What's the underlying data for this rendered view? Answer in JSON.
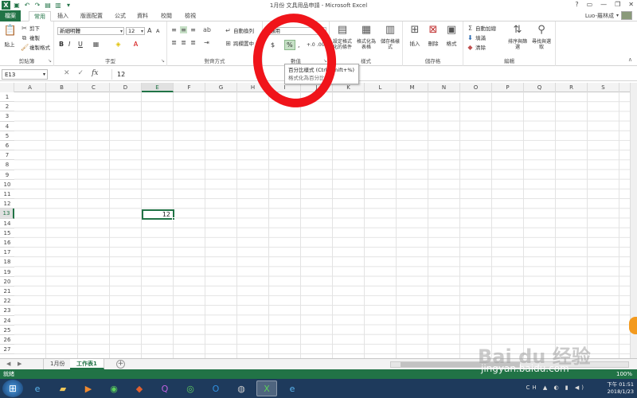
{
  "window": {
    "title": "1月份 文具用品申請 - Microsoft Excel",
    "controls": [
      "?",
      "▭",
      "—",
      "❐",
      "✕"
    ]
  },
  "tabs": [
    "檔案",
    "常用",
    "插入",
    "版面配置",
    "公式",
    "資料",
    "校閱",
    "檢視"
  ],
  "active_tab": "常用",
  "user": {
    "name": "Luo-羅林成"
  },
  "ribbon": {
    "clipboard": {
      "label": "剪貼簿",
      "paste": "貼上",
      "cut": "剪下",
      "copy": "複製",
      "format_painter": "複製格式"
    },
    "font": {
      "label": "字型",
      "font_name": "新細明體",
      "font_size": "12",
      "bold": "B",
      "italic": "I",
      "underline": "U",
      "grow": "A",
      "shrink": "A"
    },
    "alignment": {
      "label": "對齊方式",
      "wrap_text": "自動換列",
      "merge_center": "跨欄置中"
    },
    "number": {
      "label": "數值",
      "format": "通用",
      "currency": "$",
      "percent": "%",
      "comma": ",",
      "increase_decimal": "+.0",
      "decrease_decimal": ".00"
    },
    "styles": {
      "label": "樣式",
      "conditional": "設定格式化的條件",
      "format_table": "格式化為表格",
      "cell_styles": "儲存格樣式"
    },
    "cells": {
      "label": "儲存格",
      "insert": "插入",
      "delete": "刪除",
      "format": "格式"
    },
    "editing": {
      "label": "編輯",
      "autosum": "自動加總",
      "fill": "填滿",
      "clear": "清除",
      "sort_filter": "排序與篩選",
      "find_select": "尋找與選取"
    }
  },
  "tooltip": {
    "line1": "百分比樣式 (Ctrl+Shift+%)",
    "line2": "格式化為百分比。"
  },
  "formula_bar": {
    "name_box": "E13",
    "cancel": "✕",
    "enter": "✓",
    "fx": "fx",
    "value": "12"
  },
  "columns": [
    "A",
    "B",
    "C",
    "D",
    "E",
    "F",
    "G",
    "H",
    "I",
    "J",
    "K",
    "L",
    "M",
    "N",
    "O",
    "P",
    "Q",
    "R",
    "S"
  ],
  "selected_column": "E",
  "rows": [
    "1",
    "2",
    "3",
    "4",
    "5",
    "6",
    "7",
    "8",
    "9",
    "10",
    "11",
    "12",
    "13",
    "14",
    "15",
    "16",
    "17",
    "18",
    "19",
    "20",
    "21",
    "22",
    "23",
    "24",
    "25",
    "26",
    "27"
  ],
  "selected_row": "13",
  "active_cell": {
    "ref": "E13",
    "value": "12"
  },
  "sheets": [
    "1月份",
    "工作表1"
  ],
  "active_sheet": "工作表1",
  "add_sheet": "+",
  "status": {
    "text": "就緒",
    "zoom": "100%"
  },
  "watermark": {
    "brand": "Bai du 经验",
    "url": "jingyan.baidu.com"
  },
  "taskbar": {
    "apps": [
      "ie-icon",
      "folder-icon",
      "media-player-icon",
      "green-app-icon",
      "foxmail-icon",
      "q-app-icon",
      "wechat-icon",
      "outlook-icon",
      "camera-icon",
      "excel-icon",
      "ie2-icon"
    ],
    "time": "下午 01:51",
    "date": "2018/1/23",
    "lang": "CH"
  },
  "colors": {
    "excel_green": "#217346",
    "annotation_red": "#f0141a",
    "taskbar": "#1e3a5c"
  }
}
